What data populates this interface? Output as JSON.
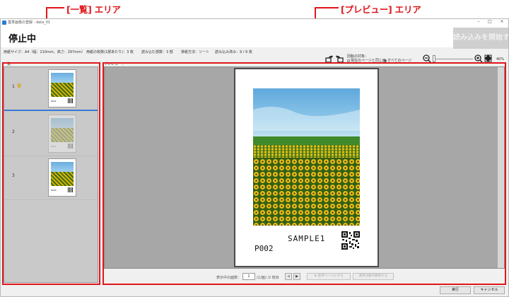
{
  "annotations": {
    "list_area": "[一覧] エリア",
    "preview_area": "[プレビュー] エリア",
    "color": "#e0161b"
  },
  "window": {
    "title": "基準画像の登録 - data_01",
    "controls": [
      "–",
      "□",
      "×"
    ]
  },
  "header": {
    "status": "停止中",
    "start_button": "読み込みを開始する"
  },
  "info": {
    "paper_size": "用紙サイズ：A4（幅：210mm、高さ：297mm）",
    "sheets_per_copy": "用紙の枚数(1部あたり)：3 枚",
    "copies": "読み込む部数：3 部",
    "sort": "排紙方法：ソート",
    "read_count": "読み込み済み：9 / 9 枚"
  },
  "rotate": {
    "left_icon": "rotate-left-icon",
    "right_icon": "rotate-right-icon"
  },
  "rotate_target": {
    "label": "回転の対象：",
    "option_current": "現在のページと同じ面",
    "option_all": "すべてのページ",
    "selected": "option_all"
  },
  "zoom": {
    "out_icon": "zoom-out-icon",
    "in_icon": "zoom-in-icon",
    "fit_icon": "fit-icon",
    "value": "40%"
  },
  "list": {
    "label": "一覧：",
    "items": [
      {
        "number": "1",
        "master": true,
        "dim": false,
        "text": "P001"
      },
      {
        "number": "2",
        "master": false,
        "dim": true,
        "text": "P002"
      },
      {
        "number": "3",
        "master": false,
        "dim": false,
        "text": "P003"
      }
    ]
  },
  "preview": {
    "label": "プレビュー：",
    "sample_text": "SAMPLE1",
    "page_id": "P002"
  },
  "pagination": {
    "label": "表示中の面数：",
    "current": "1",
    "total": "(1/面) /2 枚目",
    "prev_label": "◀",
    "next_label": "▶",
    "set_master": "基準ページにする",
    "delete_target": "基準対象の解除する"
  },
  "actions": {
    "run": "実行",
    "cancel": "キャンセル"
  }
}
